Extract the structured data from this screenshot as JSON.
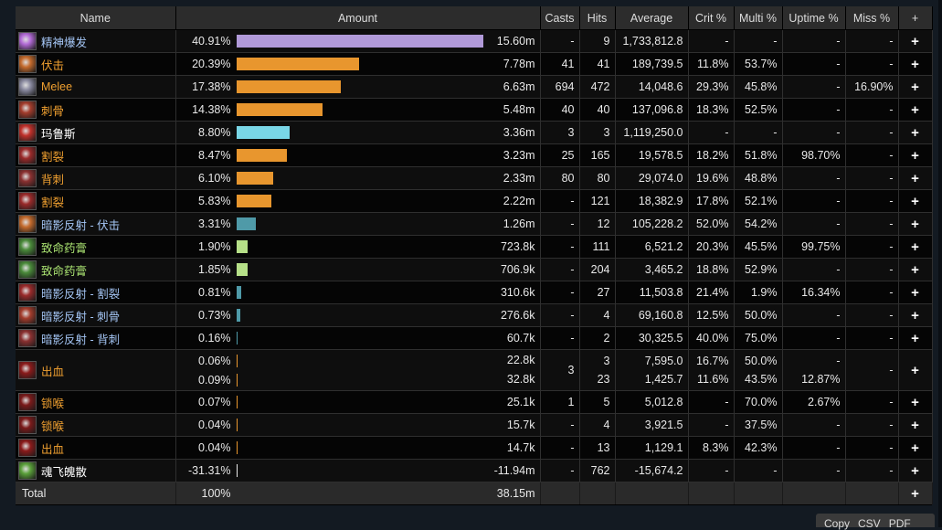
{
  "columns": [
    "Name",
    "Amount",
    "Casts",
    "Hits",
    "Average",
    "Crit %",
    "Multi %",
    "Uptime %",
    "Miss %",
    "+"
  ],
  "rows": [
    {
      "name": "精神爆发",
      "name_color": "#a3c4f3",
      "icon": "purple-spell-icon",
      "icon_color": "#b36bd6",
      "pct": "40.91%",
      "bar_fraction": 1.0,
      "bar_color": "#b19ad9",
      "amount": "15.60m",
      "casts": "-",
      "hits": "9",
      "avg": "1,733,812.8",
      "crit": "-",
      "multi": "-",
      "uptime": "-",
      "miss": "-"
    },
    {
      "name": "伏击",
      "name_color": "#f0a030",
      "icon": "ambush-icon",
      "icon_color": "#c46a2c",
      "pct": "20.39%",
      "bar_fraction": 0.4985,
      "bar_color": "#e8962e",
      "amount": "7.78m",
      "casts": "41",
      "hits": "41",
      "avg": "189,739.5",
      "crit": "11.8%",
      "multi": "53.7%",
      "uptime": "-",
      "miss": "-"
    },
    {
      "name": "Melee",
      "name_color": "#f0a030",
      "icon": "sword-icon",
      "icon_color": "#8a8aa0",
      "pct": "17.38%",
      "bar_fraction": 0.4249,
      "bar_color": "#e8962e",
      "amount": "6.63m",
      "casts": "694",
      "hits": "472",
      "avg": "14,048.6",
      "crit": "29.3%",
      "multi": "45.8%",
      "uptime": "-",
      "miss": "16.90%"
    },
    {
      "name": "刺骨",
      "name_color": "#f0a030",
      "icon": "eviscerate-icon",
      "icon_color": "#a33c2c",
      "pct": "14.38%",
      "bar_fraction": 0.3515,
      "bar_color": "#e8962e",
      "amount": "5.48m",
      "casts": "40",
      "hits": "40",
      "avg": "137,096.8",
      "crit": "18.3%",
      "multi": "52.5%",
      "uptime": "-",
      "miss": "-"
    },
    {
      "name": "玛鲁斯",
      "name_color": "#ffffff",
      "icon": "red-spell-icon",
      "icon_color": "#c0302a",
      "pct": "8.80%",
      "bar_fraction": 0.2151,
      "bar_color": "#79d6e6",
      "amount": "3.36m",
      "casts": "3",
      "hits": "3",
      "avg": "1,119,250.0",
      "crit": "-",
      "multi": "-",
      "uptime": "-",
      "miss": "-"
    },
    {
      "name": "割裂",
      "name_color": "#f0a030",
      "icon": "rupture-icon",
      "icon_color": "#9a2a2a",
      "pct": "8.47%",
      "bar_fraction": 0.207,
      "bar_color": "#e8962e",
      "amount": "3.23m",
      "casts": "25",
      "hits": "165",
      "avg": "19,578.5",
      "crit": "18.2%",
      "multi": "51.8%",
      "uptime": "98.70%",
      "miss": "-"
    },
    {
      "name": "背刺",
      "name_color": "#f0a030",
      "icon": "backstab-icon",
      "icon_color": "#8a3030",
      "pct": "6.10%",
      "bar_fraction": 0.1491,
      "bar_color": "#e8962e",
      "amount": "2.33m",
      "casts": "80",
      "hits": "80",
      "avg": "29,074.0",
      "crit": "19.6%",
      "multi": "48.8%",
      "uptime": "-",
      "miss": "-"
    },
    {
      "name": "割裂",
      "name_color": "#f0a030",
      "icon": "rupture-icon",
      "icon_color": "#9a2a2a",
      "pct": "5.83%",
      "bar_fraction": 0.1425,
      "bar_color": "#e8962e",
      "amount": "2.22m",
      "casts": "-",
      "hits": "121",
      "avg": "18,382.9",
      "crit": "17.8%",
      "multi": "52.1%",
      "uptime": "-",
      "miss": "-"
    },
    {
      "name": "暗影反射 - 伏击",
      "name_color": "#a3c4f3",
      "icon": "ambush-icon",
      "icon_color": "#c46a2c",
      "pct": "3.31%",
      "bar_fraction": 0.0809,
      "bar_color": "#4f9aa8",
      "amount": "1.26m",
      "casts": "-",
      "hits": "12",
      "avg": "105,228.2",
      "crit": "52.0%",
      "multi": "54.2%",
      "uptime": "-",
      "miss": "-"
    },
    {
      "name": "致命药膏",
      "name_color": "#a8e070",
      "icon": "poison-icon",
      "icon_color": "#4a8a3a",
      "pct": "1.90%",
      "bar_fraction": 0.0464,
      "bar_color": "#b6e088",
      "amount": "723.8k",
      "casts": "-",
      "hits": "111",
      "avg": "6,521.2",
      "crit": "20.3%",
      "multi": "45.5%",
      "uptime": "99.75%",
      "miss": "-"
    },
    {
      "name": "致命药膏",
      "name_color": "#a8e070",
      "icon": "poison-icon",
      "icon_color": "#4a8a3a",
      "pct": "1.85%",
      "bar_fraction": 0.0452,
      "bar_color": "#b6e088",
      "amount": "706.9k",
      "casts": "-",
      "hits": "204",
      "avg": "3,465.2",
      "crit": "18.8%",
      "multi": "52.9%",
      "uptime": "-",
      "miss": "-"
    },
    {
      "name": "暗影反射 - 割裂",
      "name_color": "#a3c4f3",
      "icon": "rupture-icon",
      "icon_color": "#9a2a2a",
      "pct": "0.81%",
      "bar_fraction": 0.0198,
      "bar_color": "#4f9aa8",
      "amount": "310.6k",
      "casts": "-",
      "hits": "27",
      "avg": "11,503.8",
      "crit": "21.4%",
      "multi": "1.9%",
      "uptime": "16.34%",
      "miss": "-"
    },
    {
      "name": "暗影反射 - 刺骨",
      "name_color": "#a3c4f3",
      "icon": "eviscerate-icon",
      "icon_color": "#a33c2c",
      "pct": "0.73%",
      "bar_fraction": 0.0178,
      "bar_color": "#4f9aa8",
      "amount": "276.6k",
      "casts": "-",
      "hits": "4",
      "avg": "69,160.8",
      "crit": "12.5%",
      "multi": "50.0%",
      "uptime": "-",
      "miss": "-"
    },
    {
      "name": "暗影反射 - 背刺",
      "name_color": "#a3c4f3",
      "icon": "backstab-icon",
      "icon_color": "#8a3030",
      "pct": "0.16%",
      "bar_fraction": 0.0039,
      "bar_color": "#4f9aa8",
      "amount": "60.7k",
      "casts": "-",
      "hits": "2",
      "avg": "30,325.5",
      "crit": "40.0%",
      "multi": "75.0%",
      "uptime": "-",
      "miss": "-"
    },
    {
      "name": "出血",
      "name_color": "#f0a030",
      "icon": "hemorrhage-icon",
      "icon_color": "#8a1a1a",
      "double": true,
      "pct": "0.06%",
      "pct2": "0.09%",
      "bar_fraction": 0.0015,
      "bar_fraction2": 0.0022,
      "bar_color": "#e8962e",
      "amount": "22.8k",
      "amount2": "32.8k",
      "casts": "3",
      "casts2": "",
      "hits": "3",
      "hits2": "23",
      "avg": "7,595.0",
      "avg2": "1,425.7",
      "crit": "16.7%",
      "crit2": "11.6%",
      "multi": "50.0%",
      "multi2": "43.5%",
      "uptime": "-",
      "uptime2": "12.87%",
      "miss": "-"
    },
    {
      "name": "锁喉",
      "name_color": "#f0a030",
      "icon": "garrote-icon",
      "icon_color": "#7a1a1a",
      "pct": "0.07%",
      "bar_fraction": 0.0017,
      "bar_color": "#e8962e",
      "amount": "25.1k",
      "casts": "1",
      "hits": "5",
      "avg": "5,012.8",
      "crit": "-",
      "multi": "70.0%",
      "uptime": "2.67%",
      "miss": "-"
    },
    {
      "name": "锁喉",
      "name_color": "#f0a030",
      "icon": "garrote-icon",
      "icon_color": "#7a1a1a",
      "pct": "0.04%",
      "bar_fraction": 0.001,
      "bar_color": "#e8962e",
      "amount": "15.7k",
      "casts": "-",
      "hits": "4",
      "avg": "3,921.5",
      "crit": "-",
      "multi": "37.5%",
      "uptime": "-",
      "miss": "-"
    },
    {
      "name": "出血",
      "name_color": "#f0a030",
      "icon": "hemorrhage-icon",
      "icon_color": "#8a1a1a",
      "pct": "0.04%",
      "bar_fraction": 0.001,
      "bar_color": "#e8962e",
      "amount": "14.7k",
      "casts": "-",
      "hits": "13",
      "avg": "1,129.1",
      "crit": "8.3%",
      "multi": "42.3%",
      "uptime": "-",
      "miss": "-"
    },
    {
      "name": "魂飞魄散",
      "name_color": "#ffffff",
      "icon": "green-spell-icon",
      "icon_color": "#5aa03a",
      "pct": "-31.31%",
      "bar_fraction": 0.0,
      "bar_color": "#e8e8e8",
      "amount": "-11.94m",
      "casts": "-",
      "hits": "762",
      "avg": "-15,674.2",
      "crit": "-",
      "multi": "-",
      "uptime": "-",
      "miss": "-"
    }
  ],
  "total": {
    "label": "Total",
    "pct": "100%",
    "amount": "38.15m",
    "plus": "+"
  },
  "export": [
    "Copy",
    "CSV",
    "PDF"
  ]
}
